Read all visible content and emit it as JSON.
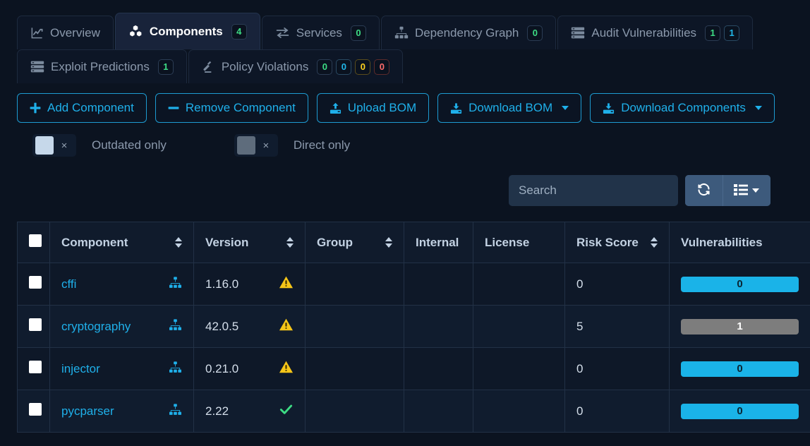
{
  "tabs_row1": [
    {
      "label": "Overview",
      "icon": "chart-line-icon",
      "active": false,
      "badges": []
    },
    {
      "label": "Components",
      "icon": "cubes-icon",
      "active": true,
      "badges": [
        {
          "value": "4",
          "color": "green"
        }
      ]
    },
    {
      "label": "Services",
      "icon": "exchange-icon",
      "active": false,
      "badges": [
        {
          "value": "0",
          "color": "green"
        }
      ]
    },
    {
      "label": "Dependency Graph",
      "icon": "sitemap-icon",
      "active": false,
      "badges": [
        {
          "value": "0",
          "color": "green"
        }
      ]
    },
    {
      "label": "Audit Vulnerabilities",
      "icon": "server-icon",
      "active": false,
      "badges": [
        {
          "value": "1",
          "color": "green"
        },
        {
          "value": "1",
          "color": "blue"
        }
      ]
    }
  ],
  "tabs_row2": [
    {
      "label": "Exploit Predictions",
      "icon": "server-icon",
      "active": false,
      "badges": [
        {
          "value": "1",
          "color": "green"
        }
      ]
    },
    {
      "label": "Policy Violations",
      "icon": "gavel-icon",
      "active": false,
      "badges": [
        {
          "value": "0",
          "color": "green"
        },
        {
          "value": "0",
          "color": "blue"
        },
        {
          "value": "0",
          "color": "yellow"
        },
        {
          "value": "0",
          "color": "red"
        }
      ]
    }
  ],
  "actions": [
    {
      "label": "Add Component",
      "icon": "plus-icon",
      "dropdown": false
    },
    {
      "label": "Remove Component",
      "icon": "minus-icon",
      "dropdown": false
    },
    {
      "label": "Upload BOM",
      "icon": "upload-icon",
      "dropdown": false
    },
    {
      "label": "Download BOM",
      "icon": "download-icon",
      "dropdown": true
    },
    {
      "label": "Download Components",
      "icon": "download-icon",
      "dropdown": true
    }
  ],
  "filters": [
    {
      "label": "Outdated only",
      "state": "on",
      "off_mark": "×"
    },
    {
      "label": "Direct only",
      "state": "off",
      "off_mark": "×"
    }
  ],
  "search": {
    "value": "",
    "placeholder": "Search"
  },
  "toolbar_icons": {
    "refresh": "refresh-icon",
    "columns": "list-columns-icon"
  },
  "table": {
    "columns": [
      {
        "label": "",
        "sortable": false,
        "key": "select",
        "cls": "c-chk"
      },
      {
        "label": "Component",
        "sortable": true,
        "key": "component",
        "cls": "c-comp"
      },
      {
        "label": "Version",
        "sortable": true,
        "key": "version",
        "cls": "c-ver"
      },
      {
        "label": "Group",
        "sortable": true,
        "key": "group",
        "cls": "c-grp"
      },
      {
        "label": "Internal",
        "sortable": false,
        "key": "internal",
        "cls": "c-int"
      },
      {
        "label": "License",
        "sortable": false,
        "key": "license",
        "cls": "c-lic"
      },
      {
        "label": "Risk Score",
        "sortable": true,
        "key": "risk",
        "cls": "c-risk"
      },
      {
        "label": "Vulnerabilities",
        "sortable": false,
        "key": "vulns",
        "cls": "c-vuln"
      }
    ],
    "rows": [
      {
        "component": "cffi",
        "version": "1.16.0",
        "version_status": "warning",
        "group": "",
        "internal": "",
        "license": "",
        "risk": "0",
        "vulnerabilities": "0",
        "vuln_state": "zero"
      },
      {
        "component": "cryptography",
        "version": "42.0.5",
        "version_status": "warning",
        "group": "",
        "internal": "",
        "license": "",
        "risk": "5",
        "vulnerabilities": "1",
        "vuln_state": "some"
      },
      {
        "component": "injector",
        "version": "0.21.0",
        "version_status": "warning",
        "group": "",
        "internal": "",
        "license": "",
        "risk": "0",
        "vulnerabilities": "0",
        "vuln_state": "zero"
      },
      {
        "component": "pycparser",
        "version": "2.22",
        "version_status": "ok",
        "group": "",
        "internal": "",
        "license": "",
        "risk": "0",
        "vulnerabilities": "0",
        "vuln_state": "zero"
      }
    ]
  },
  "colors": {
    "accent_blue": "#1fb0ea",
    "badge_green": "#3ddc84",
    "badge_blue": "#21b7e8",
    "badge_yellow": "#ffd21e",
    "badge_red": "#ff6b6b",
    "warning_yellow": "#f5c518",
    "ok_green": "#3ddc84",
    "vuln_zero": "#1ab3e8",
    "vuln_some": "#7d7d7d",
    "page_bg": "#0b1320"
  }
}
